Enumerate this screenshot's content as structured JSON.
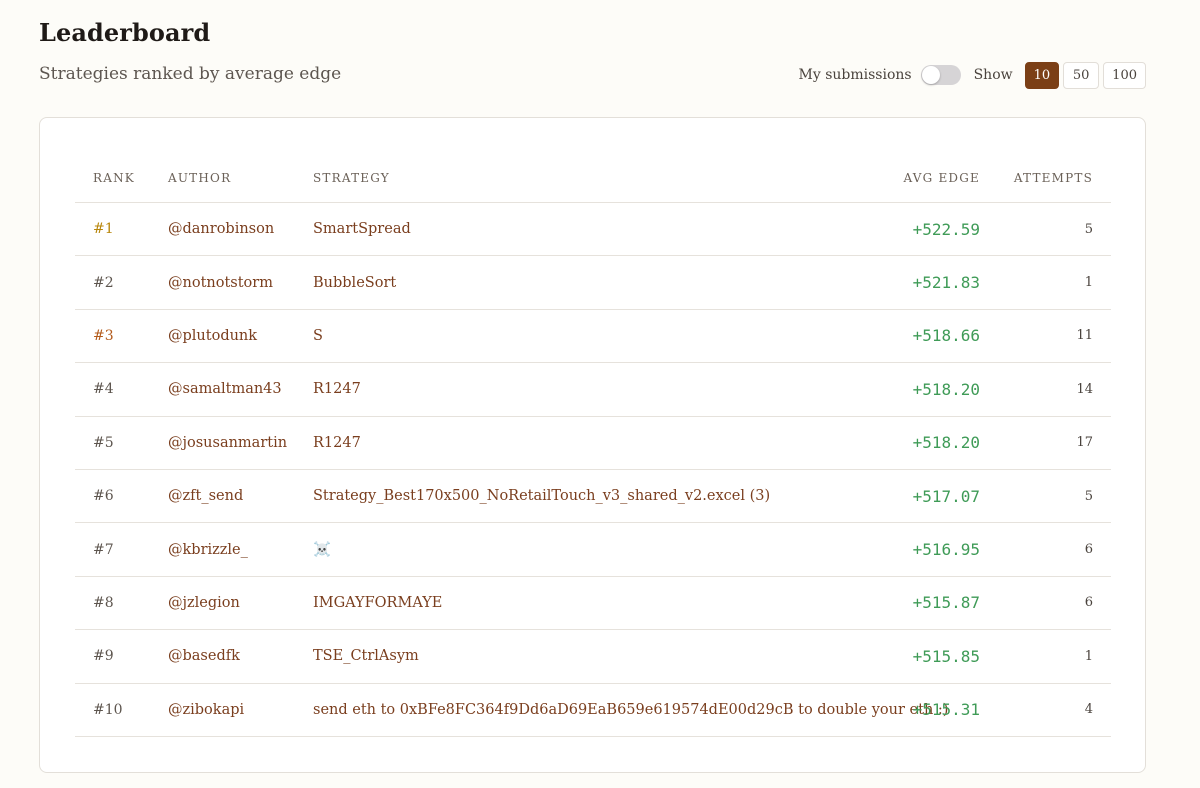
{
  "header": {
    "title": "Leaderboard",
    "subtitle": "Strategies ranked by average edge"
  },
  "controls": {
    "my_submissions_label": "My submissions",
    "my_submissions_on": false,
    "show_label": "Show",
    "page_sizes": [
      "10",
      "50",
      "100"
    ],
    "selected_page_size": "10"
  },
  "table": {
    "columns": {
      "rank": "RANK",
      "author": "AUTHOR",
      "strategy": "STRATEGY",
      "avg_edge": "AVG EDGE",
      "attempts": "ATTEMPTS"
    },
    "rows": [
      {
        "rank": "#1",
        "author": "@danrobinson",
        "strategy": "SmartSpread",
        "avg_edge": "+522.59",
        "attempts": "5"
      },
      {
        "rank": "#2",
        "author": "@notnotstorm",
        "strategy": "BubbleSort",
        "avg_edge": "+521.83",
        "attempts": "1"
      },
      {
        "rank": "#3",
        "author": "@plutodunk",
        "strategy": "S",
        "avg_edge": "+518.66",
        "attempts": "11"
      },
      {
        "rank": "#4",
        "author": "@samaltman43",
        "strategy": "R1247",
        "avg_edge": "+518.20",
        "attempts": "14"
      },
      {
        "rank": "#5",
        "author": "@josusanmartin",
        "strategy": "R1247",
        "avg_edge": "+518.20",
        "attempts": "17"
      },
      {
        "rank": "#6",
        "author": "@zft_send",
        "strategy": "Strategy_Best170x500_NoRetailTouch_v3_shared_v2.excel (3)",
        "avg_edge": "+517.07",
        "attempts": "5"
      },
      {
        "rank": "#7",
        "author": "@kbrizzle_",
        "strategy": "☠️",
        "avg_edge": "+516.95",
        "attempts": "6"
      },
      {
        "rank": "#8",
        "author": "@jzlegion",
        "strategy": "IMGAYFORMAYE",
        "avg_edge": "+515.87",
        "attempts": "6"
      },
      {
        "rank": "#9",
        "author": "@basedfk",
        "strategy": "TSE_CtrlAsym",
        "avg_edge": "+515.85",
        "attempts": "1"
      },
      {
        "rank": "#10",
        "author": "@zibokapi",
        "strategy": "send eth to 0xBFe8FC364f9Dd6aD69EaB659e619574dE00d29cB to double your eth :)",
        "avg_edge": "+515.31",
        "attempts": "4"
      }
    ]
  },
  "colors": {
    "accent": "#7b3f16",
    "positive": "#3f9b57",
    "gold": "#b8860b",
    "bronze": "#b35a1a"
  }
}
